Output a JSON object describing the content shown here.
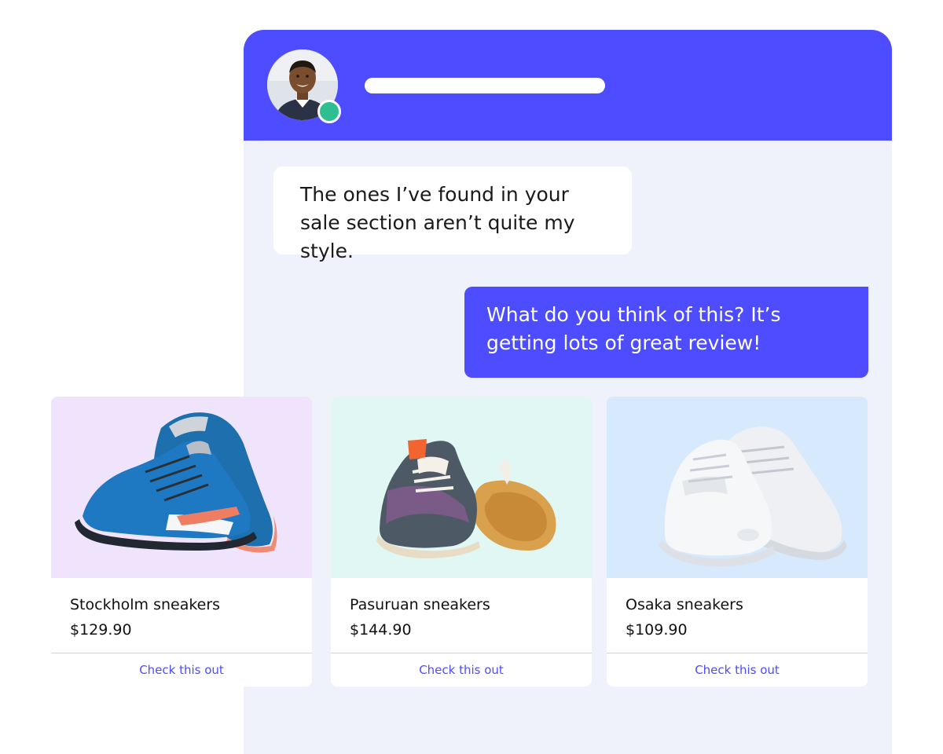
{
  "colors": {
    "accent": "#4d4cff",
    "chat_background": "#eff2fa",
    "online": "#2ebf91",
    "card_bg_1": "#f0e3fc",
    "card_bg_2": "#e0f7f3",
    "card_bg_3": "#d6e9fd"
  },
  "header": {
    "avatar_icon": "user-avatar-photo",
    "status_icon": "online-status-dot"
  },
  "messages": [
    {
      "sender": "customer",
      "text": "The ones I’ve found in your sale section aren’t quite my style."
    },
    {
      "sender": "agent",
      "text": "What do you think of this? It’s getting lots of great review!"
    }
  ],
  "products": [
    {
      "name": "Stockholm sneakers",
      "price": "$129.90",
      "cta": "Check this out",
      "image_icon": "blue-sneaker-photo"
    },
    {
      "name": "Pasuruan sneakers",
      "price": "$144.90",
      "cta": "Check this out",
      "image_icon": "patterned-sneaker-photo"
    },
    {
      "name": "Osaka sneakers",
      "price": "$109.90",
      "cta": "Check this out",
      "image_icon": "white-sneaker-photo"
    }
  ]
}
